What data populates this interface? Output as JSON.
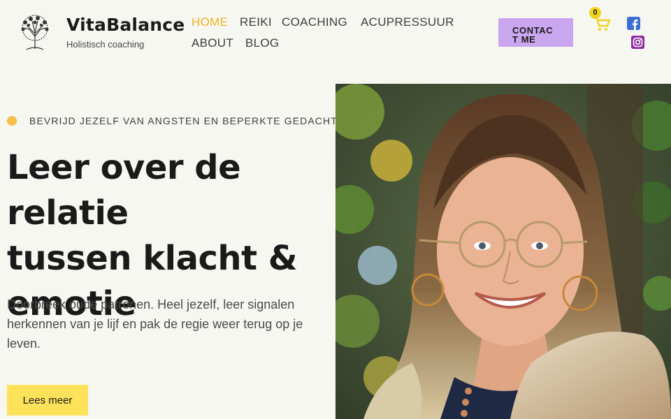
{
  "brand": {
    "name": "VitaBalance",
    "tagline": "Holistisch coaching"
  },
  "nav": {
    "items": [
      {
        "label": "HOME",
        "active": true
      },
      {
        "label": "REIKI",
        "active": false
      },
      {
        "label": "COACHING",
        "active": false
      },
      {
        "label": "ACUPRESSUUR",
        "active": false
      },
      {
        "label": "ABOUT",
        "active": false
      },
      {
        "label": "BLOG",
        "active": false
      }
    ]
  },
  "header": {
    "contact_line1": "CONTAC",
    "contact_line2": "T ME",
    "cart_count": "0",
    "icons": [
      "cart-icon",
      "facebook-icon",
      "instagram-icon"
    ]
  },
  "hero": {
    "eyebrow": "BEVRIJD JEZELF VAN ANGSTEN EN BEPERKTE GEDACHTEN",
    "headline_line1": "Leer over de relatie",
    "headline_line2": "tussen klacht &",
    "headline_line3": "emotie",
    "lead": "Doorbreek oude patronen. Heel jezelf, leer signalen herkennen van je lijf en pak de regie weer terug op je leven.",
    "cta_label": "Lees meer"
  },
  "colors": {
    "background": "#f7f7f1",
    "accent": "#f2b31f",
    "contact_button": "#c9a6ee",
    "cta_button": "#fde25a",
    "bullet": "#f7c04a"
  }
}
